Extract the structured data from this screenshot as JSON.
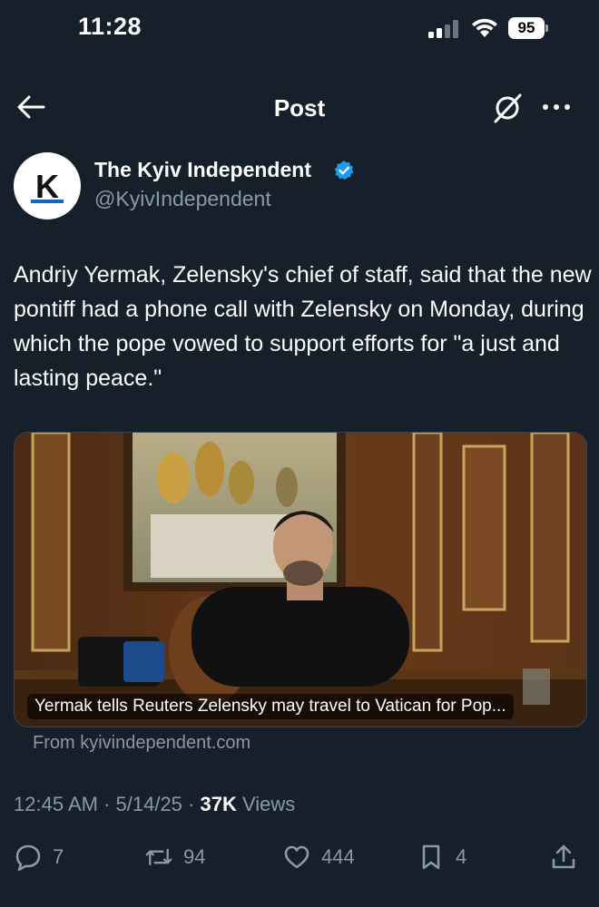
{
  "status_bar": {
    "time": "11:28",
    "battery": "95"
  },
  "header": {
    "title": "Post"
  },
  "author": {
    "name": "The Kyiv Independent",
    "handle": "@KyivIndependent",
    "avatar_letter": "K"
  },
  "post": {
    "text": "Andriy Yermak, Zelensky's chief of staff, said that the new pontiff had a phone call with Zelensky on Monday, during which the pope vowed to support efforts for \"a just and lasting peace.\""
  },
  "card": {
    "caption": "Yermak tells Reuters Zelensky may travel to Vatican for Pop...",
    "source": "From kyivindependent.com"
  },
  "meta": {
    "time": "12:45 AM",
    "date": "5/14/25",
    "views_count": "37K",
    "views_label": "Views"
  },
  "actions": {
    "replies": "7",
    "reposts": "94",
    "likes": "444",
    "bookmarks": "4"
  },
  "colors": {
    "background": "#15202b",
    "secondary_text": "#8b98a5",
    "verified": "#1d9bf0"
  }
}
